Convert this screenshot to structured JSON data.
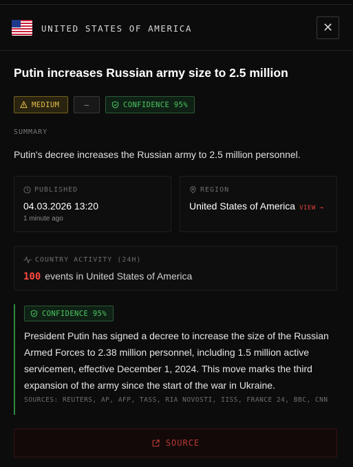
{
  "header": {
    "country_name": "UNITED STATES OF AMERICA",
    "close_label": "✕"
  },
  "event": {
    "title": "Putin increases Russian army size to 2.5 million",
    "badges": {
      "severity": "MEDIUM",
      "dash": "—",
      "confidence": "CONFIDENCE 95%"
    },
    "summary_label": "SUMMARY",
    "summary": "Putin's decree increases the Russian army to 2.5 million personnel."
  },
  "published": {
    "label": "PUBLISHED",
    "date": "04.03.2026 13:20",
    "relative": "1 minute ago"
  },
  "region": {
    "label": "REGION",
    "value": "United States of America",
    "view_label": "VIEW →"
  },
  "activity": {
    "label": "COUNTRY ACTIVITY (24H)",
    "count": "100",
    "text": "events in United States of America"
  },
  "detail": {
    "confidence": "CONFIDENCE 95%",
    "body": "President Putin has signed a decree to increase the size of the Russian Armed Forces to 2.38 million personnel, including 1.5 million active servicemen, effective December 1, 2024. This move marks the third expansion of the army since the start of the war in Ukraine.",
    "sources": "SOURCES: REUTERS, AP, AFP, TASS, RIA NOVOSTI, IISS, FRANCE 24, BBC, CNN"
  },
  "source_button": {
    "label": "SOURCE"
  },
  "colors": {
    "accent_red": "#e0433a",
    "confidence_green": "#4cc864",
    "medium_yellow": "#e8c24a"
  }
}
